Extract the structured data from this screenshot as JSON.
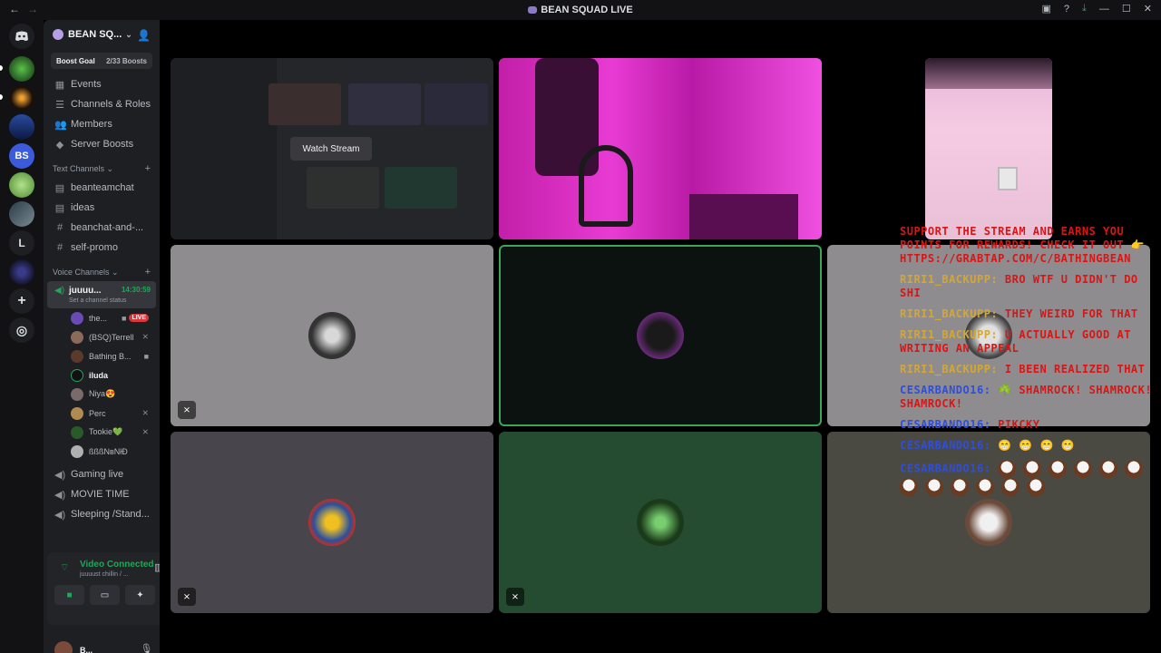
{
  "window": {
    "title": "BEAN SQUAD LIVE",
    "back_label": "←",
    "forward_label": "→",
    "icons": [
      "inbox-icon",
      "help-icon",
      "download-icon",
      "minimize-icon",
      "maximize-icon",
      "close-icon"
    ],
    "control_glyphs": [
      "▣",
      "?",
      "⤓",
      "—",
      "☐",
      "✕"
    ]
  },
  "rail": {
    "items": [
      {
        "name": "discord-home",
        "glyph": "◉",
        "color": "#1e1f22"
      },
      {
        "name": "server-1",
        "glyph": "",
        "color": "#2f6b2f"
      },
      {
        "name": "server-2",
        "glyph": "",
        "color": "#3a2a12"
      },
      {
        "name": "server-3",
        "glyph": "",
        "color": "#1a3a7a"
      },
      {
        "name": "server-bs",
        "glyph": "BS",
        "color": "#3b5bdb"
      },
      {
        "name": "server-5",
        "glyph": "",
        "color": "#7bbf63"
      },
      {
        "name": "server-6",
        "glyph": "",
        "color": "#4a5560"
      },
      {
        "name": "server-l",
        "glyph": "L",
        "color": "#1e1f22"
      },
      {
        "name": "server-8",
        "glyph": "",
        "color": "#2a2a5a"
      },
      {
        "name": "add-server",
        "glyph": "+",
        "color": "#1e1f22"
      },
      {
        "name": "discover",
        "glyph": "◎",
        "color": "#1e1f22"
      }
    ]
  },
  "server": {
    "name": "BEAN SQ...",
    "boost_goal": "Boost Goal",
    "boost_count": "2/33 Boosts",
    "nav": [
      {
        "label": "Events",
        "icon": "calendar-icon",
        "glyph": "▦"
      },
      {
        "label": "Channels & Roles",
        "icon": "channels-icon",
        "glyph": "☰"
      },
      {
        "label": "Members",
        "icon": "members-icon",
        "glyph": "👥"
      },
      {
        "label": "Server Boosts",
        "icon": "boost-icon",
        "glyph": "◆"
      }
    ],
    "text_category": "Text Channels",
    "text_channels": [
      {
        "label": "beanteamchat",
        "glyph": "▤"
      },
      {
        "label": "ideas",
        "glyph": "▤"
      },
      {
        "label": "beanchat-and-...",
        "glyph": "#"
      },
      {
        "label": "self-promo",
        "glyph": "#"
      }
    ],
    "voice_category": "Voice Channels",
    "active_voice": {
      "name": "juuuu...",
      "time": "14:30:59",
      "status": "Set a channel status"
    },
    "voice_users": [
      {
        "name": "the...",
        "color": "#6a4bb5",
        "live": "LIVE",
        "video": true
      },
      {
        "name": "(BSQ)Terrell",
        "color": "#8a6a5a",
        "muted": true
      },
      {
        "name": "Bathing B...",
        "color": "#5a3a2a",
        "video": true
      },
      {
        "name": "iluda",
        "color": "#111111",
        "bold": true
      },
      {
        "name": "Niya😍",
        "color": "#7a6a6a"
      },
      {
        "name": "Perc",
        "color": "#b08a50",
        "muted": true
      },
      {
        "name": "Tookie💚",
        "color": "#2a5a2a",
        "muted": true
      },
      {
        "name": "ßßßNвNłĐ",
        "color": "#b0b0b0"
      }
    ],
    "other_voice": [
      {
        "label": "Gaming live"
      },
      {
        "label": "MOVIE TIME"
      },
      {
        "label": "Sleeping /Stand..."
      }
    ]
  },
  "voice_panel": {
    "status": "Video Connected",
    "channel": "juuuust chillin / ...",
    "buttons": [
      "camera-button",
      "screen-share-button",
      "activities-button",
      "soundboard-button"
    ]
  },
  "user": {
    "name": "B...",
    "status": "In"
  },
  "stage": {
    "watch_label": "Watch Stream"
  },
  "chat": {
    "lines": [
      {
        "user": "",
        "text": "SUPPORT THE STREAM AND EARNS YOU POINTS FOR REWARDS! CHECK IT OUT 👉 HTTPS://GRABTAP.COM/C/BATHINGBEAN"
      },
      {
        "user": "RIRI1_BACKUPP:",
        "text": "BRO WTF U DIDN'T DO SHI",
        "ucolor": "gold"
      },
      {
        "user": "RIRI1_BACKUPP:",
        "text": "THEY WEIRD FOR THAT",
        "ucolor": "gold"
      },
      {
        "user": "RIRI1_BACKUPP:",
        "text": "U ACTUALLY GOOD AT WRITING AN APPEAL",
        "ucolor": "gold"
      },
      {
        "user": "RIRI1_BACKUPP:",
        "text": "I BEEN REALIZED THAT",
        "ucolor": "gold"
      },
      {
        "user": "CESARBANDO16:",
        "text": "☘️ SHAMROCK! SHAMROCK! SHAMROCK!",
        "ucolor": "blue"
      },
      {
        "user": "CESARBANDO16:",
        "text": "PIKCKY",
        "ucolor": "blue"
      },
      {
        "user": "CESARBANDO16:",
        "text": "😁 😁 😁 😁",
        "ucolor": "blue"
      },
      {
        "user": "CESARBANDO16:",
        "text": "",
        "ucolor": "blue"
      }
    ]
  }
}
